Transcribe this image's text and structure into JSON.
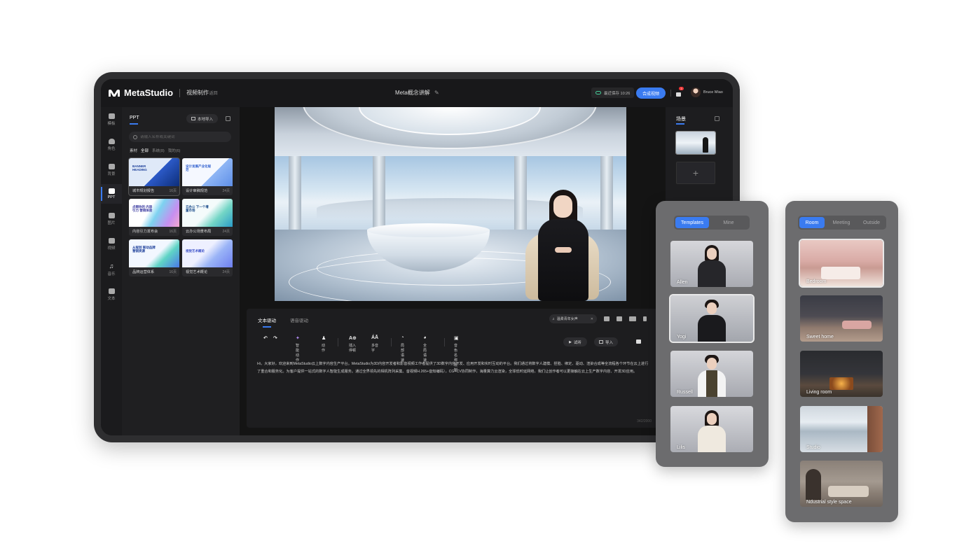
{
  "app": {
    "brand": "MetaStudio",
    "module": "视频制作",
    "back": "← 返回",
    "doc_title": "Meta概念讲解",
    "save_status": "最近保存 10:26",
    "compose_button": "合成视频",
    "notification_count": "3",
    "username": "Bruce Miao"
  },
  "left_nav": [
    {
      "label": "模板",
      "icon": "template-icon"
    },
    {
      "label": "角色",
      "icon": "person-icon"
    },
    {
      "label": "背景",
      "icon": "image-icon"
    },
    {
      "label": "PPT",
      "icon": "ppt-icon",
      "active": true
    },
    {
      "label": "图片",
      "icon": "picture-icon"
    },
    {
      "label": "视频",
      "icon": "video-icon"
    },
    {
      "label": "音乐",
      "icon": "music-icon"
    },
    {
      "label": "文本",
      "icon": "text-icon"
    }
  ],
  "ppt_panel": {
    "tab": "PPT",
    "local_import": "本地导入",
    "search_placeholder": "请输入名称或关键词",
    "filters": {
      "label": "素材",
      "items": [
        "全部",
        "系统(8)",
        "我的(6)"
      ],
      "active": "全部"
    },
    "cards": [
      {
        "name": "城市规划报告",
        "pages": "16页",
        "thumb_text": "BANNER HEADING",
        "theme": "blue"
      },
      {
        "name": "设计审稿规范",
        "pages": "24页",
        "thumb_text": "设计发展产业化规范",
        "theme": "light"
      },
      {
        "name": "内容引力发布会",
        "pages": "16页",
        "thumb_text": "点燃你的 内容引力 营销体验",
        "theme": "gradient"
      },
      {
        "name": "云办公场景布局",
        "pages": "24页",
        "thumb_text": "云办公 下一个增量市场",
        "theme": "teal"
      },
      {
        "name": "品牌运营体系",
        "pages": "16页",
        "thumb_text": "从规划 联动品牌营销资源",
        "theme": "cyan"
      },
      {
        "name": "视觉艺术概论",
        "pages": "24页",
        "thumb_text": "视觉艺术概论",
        "theme": "lilac"
      }
    ]
  },
  "editor": {
    "tabs": [
      "文本驱动",
      "语音驱动"
    ],
    "active_tab": "文本驱动",
    "voice": "温柔青年女声",
    "tools": [
      {
        "glyph": "↶",
        "label": ""
      },
      {
        "glyph": "↷",
        "label": ""
      },
      {
        "glyph": "✦",
        "label": "智能动作"
      },
      {
        "glyph": "♟",
        "label": "动作"
      },
      {
        "glyph": "A⊕",
        "label": "插入停顿"
      },
      {
        "glyph": "ÁĀ",
        "label": "多音字"
      },
      {
        "glyph": "◔",
        "label": "局部语速"
      },
      {
        "glyph": "◕",
        "label": "全局语速"
      },
      {
        "glyph": "▣",
        "label": "音色名称限制"
      }
    ],
    "trial_button": "试听",
    "import_button": "导入",
    "script": "Hi，大家好，欢迎来到MetaStudio云上数字内容生产平台。MetaStudio为3D内容开发者和影音视频工作者提供了3D数字内容开发、应用开发和实时互动的平台。我们通过将数字人建模、捏脸、绑定、驱动、渲染合成等全流程各个环节在云上进行了重合和服务化。为客户提供一站式的数字人智能生成服务。通过全界领先的相机阵列采集、音视频H.265+音知编码），CG+CV协同制作，海量算力云渲染，全球低时延网络，我们让创作者可以更接触在云上生产数字内容、开发3D应用。",
    "char_count": "342/2000"
  },
  "scene_panel": {
    "title": "场景",
    "add_label": "+"
  },
  "templates_panel": {
    "tabs": [
      "Templates",
      "Mine"
    ],
    "active_tab": "Templates",
    "items": [
      "Allen",
      "Yogi",
      "Russell",
      "Lilis"
    ],
    "selected": "Yogi"
  },
  "rooms_panel": {
    "tabs": [
      "Room",
      "Meeting",
      "Outside"
    ],
    "active_tab": "Room",
    "items": [
      "Bedroom",
      "Sweet home",
      "Living room",
      "Studio",
      "Ndustrial style space"
    ],
    "selected": "Bedroom"
  },
  "colors": {
    "accent": "#3a7bf0",
    "panel_bg": "#6c6c6e",
    "screen_bg": "#141414"
  }
}
